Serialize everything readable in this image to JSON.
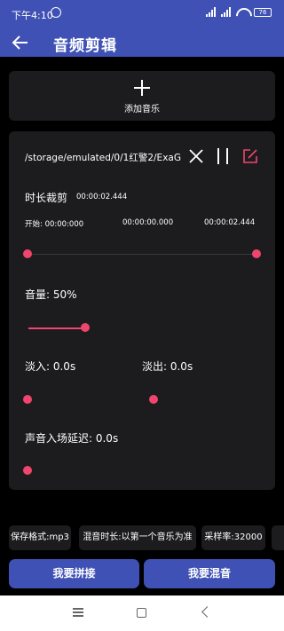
{
  "status": {
    "time": "下午4:10",
    "battery": "76"
  },
  "appbar": {
    "title": "音频剪辑"
  },
  "add": {
    "label": "添加音乐"
  },
  "file": {
    "path": "/storage/emulated/0/1红警2/ExaG…"
  },
  "trim": {
    "label": "时长裁剪",
    "duration": "00:00:02.444",
    "start_label": "开始: 00:00:000",
    "mid_time": "00:00:00.000",
    "end_time": "00:00:02.444",
    "start_value": 0,
    "end_value": 1
  },
  "volume": {
    "label": "音量: 50%",
    "value": 0.5
  },
  "fade_in": {
    "label": "淡入: 0.0s",
    "value": 0
  },
  "fade_out": {
    "label": "淡出: 0.0s",
    "value": 0
  },
  "delay": {
    "label": "声音入场延迟: 0.0s",
    "value": 0
  },
  "options": {
    "format": "保存格式:mp3",
    "mix_duration": "混音时长:以第一个音乐为准",
    "sample_rate": "采样率:32000"
  },
  "buttons": {
    "concat": "我要拼接",
    "mix": "我要混音"
  },
  "colors": {
    "primary": "#3f51b5",
    "accent": "#f0456d",
    "card": "#1c1c1e"
  }
}
